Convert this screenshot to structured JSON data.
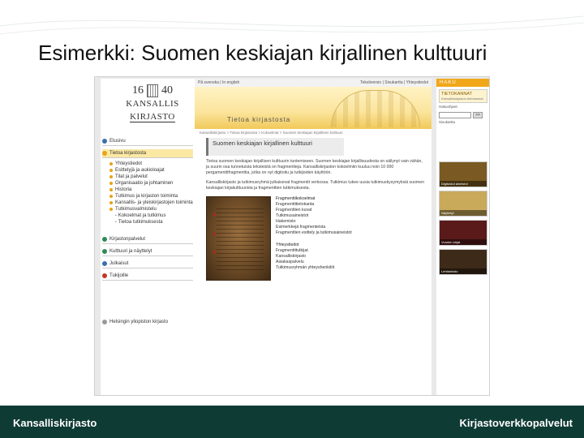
{
  "slide": {
    "title": "Esimerkki: Suomen keskiajan kirjallinen kulttuuri"
  },
  "colors": {
    "footer_bg": "#0f3b35",
    "accent": "#f0a81a",
    "banner": "#fbe49c"
  },
  "logo": {
    "year_left": "16",
    "year_right": "40",
    "name1": "KANSALLIS",
    "name2": "KIRJASTO"
  },
  "topbar": {
    "left": "På svenska | In english",
    "right": "Tekstiversio | Sivukartta | Yhteystiedot"
  },
  "banner": {
    "title": "Tietoa kirjastosta"
  },
  "crumb": "Kansalliskirjasto > Tietoa kirjastosta > Kokoelmat > Suomen keskiajan kirjallinen kulttuuri",
  "nav": {
    "sections": [
      {
        "label": "Etusivu",
        "icon": "home-icon",
        "color": "#3a6fb0"
      },
      {
        "label": "Tietoa kirjastosta",
        "icon": "info-icon",
        "color": "#e6a417"
      }
    ],
    "items": [
      "Yhteystiedot",
      "Esittelyjä ja aukioloajat",
      "Tilat ja palvelut",
      "Organisaatio ja johtaminen",
      "Historia",
      "Tutkimus ja kirjaston toiminta",
      "Kansallis- ja yleiskirjastojen toiminta",
      "Tutkimusvalmistelu"
    ],
    "subitems": [
      "Kokoelmat ja tutkimus",
      "Tietoa tutkimuksesta"
    ],
    "lower_sections": [
      {
        "label": "Kirjastonpalvelut",
        "icon": "books-icon",
        "color": "#2e8b57"
      },
      {
        "label": "Kulttuuri ja näyttelyt",
        "icon": "culture-icon",
        "color": "#2e8b57"
      },
      {
        "label": "Julkaisut",
        "icon": "publications-icon",
        "color": "#3a6fb0"
      },
      {
        "label": "Tukijoille",
        "icon": "support-icon",
        "color": "#c0392b"
      }
    ],
    "footer": "Helsingin yliopiston kirjasto"
  },
  "main": {
    "heading": "Suomen keskiajan kirjallinen kulttuuri",
    "para1": "Tietoa suomen keskiajan kirjallisen kulttuurin tuntemiseen. Suomen keskiajan kirjallisuudesta on säilynyt vain vähän, ja suurin osa tunnetuista teksteistä on fragmentteja. Kansalliskirjaston kokoelmiin kuuluu noin 10 000 pergamenttifragmenttia, jotka on nyt digitoitu ja tutkijoiden käyttöön.",
    "para2": "Kansalliskirjasto ja tutkimusryhmä julkaisevat fragmentit verkossa. Tutkimus tukee uusia tutkimuskysymyksiä suomen keskiajan kirjakulttuurista ja fragmenttien tutkimuksesta.",
    "links_head": "Fragmenttikokoelmat",
    "links": [
      "Fragmenttitietokanta",
      "Fragmenttien kuvat",
      "Tutkimusaineistot",
      "Hakemisto",
      "Esimerkkejä fragmenteista",
      "Fragmenttien esittely ja tutkimusaineistot"
    ],
    "links2_head": "Yhteystiedot",
    "links2": [
      "Fragmenttitutkijat",
      "Kansalliskirjasto",
      "Asiakaspalvelu",
      "Tutkimusryhmän yhteyshenkilöt"
    ]
  },
  "right": {
    "haku": "HAKU",
    "db": "TIETOKANNAT",
    "db_sub": "Kansalliskirjaston tietokannat",
    "search_placeholder": "",
    "go": ">>",
    "label1": "Hakuohjeet",
    "label2": "Sivukartta",
    "promos": [
      {
        "caption": "Digitoidut aineistot",
        "bg": "#7a5a22"
      },
      {
        "caption": "Näyttelyt",
        "bg": "#c9a95a"
      },
      {
        "caption": "Vuoden kirjat",
        "bg": "#5a1a1a"
      },
      {
        "caption": "Lehtiarkisto",
        "bg": "#3d2a18"
      }
    ]
  },
  "footer": {
    "left": "Kansalliskirjasto",
    "right": "Kirjastoverkkopalvelut"
  }
}
